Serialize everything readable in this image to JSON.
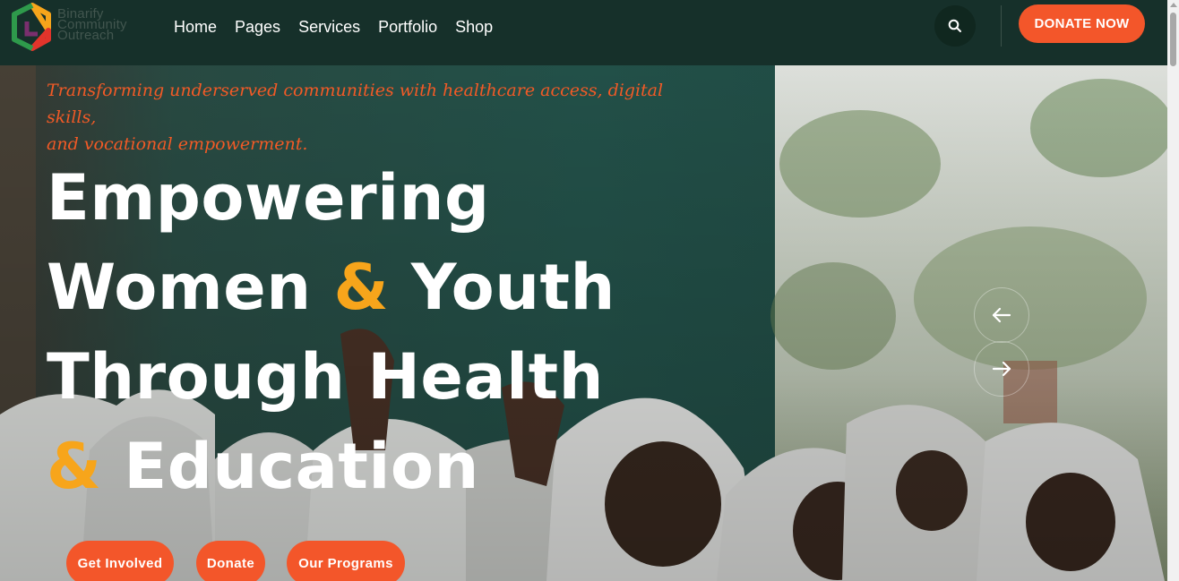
{
  "header": {
    "logo_lines": [
      "Binarify",
      "Community",
      "Outreach"
    ],
    "nav": [
      "Home",
      "Pages",
      "Services",
      "Portfolio",
      "Shop"
    ],
    "search_icon": "search-icon",
    "donate_label": "DONATE NOW"
  },
  "hero": {
    "tagline_line1": "Transforming underserved communities with healthcare access, digital skills,",
    "tagline_line2": "and vocational empowerment.",
    "headline": {
      "line1": "Empowering",
      "line2_a": "Women",
      "amp": "&",
      "line2_b": "Youth",
      "line3": "Through Health",
      "line4_b": "Education"
    },
    "prev_icon": "arrow-left-icon",
    "next_icon": "arrow-right-icon",
    "buttons": [
      "Get Involved",
      "Donate",
      "Our Programs"
    ]
  },
  "colors": {
    "header_bg": "#16302a",
    "accent": "#f3562a",
    "amp": "#f7a51b",
    "tagline": "#f25a26"
  }
}
